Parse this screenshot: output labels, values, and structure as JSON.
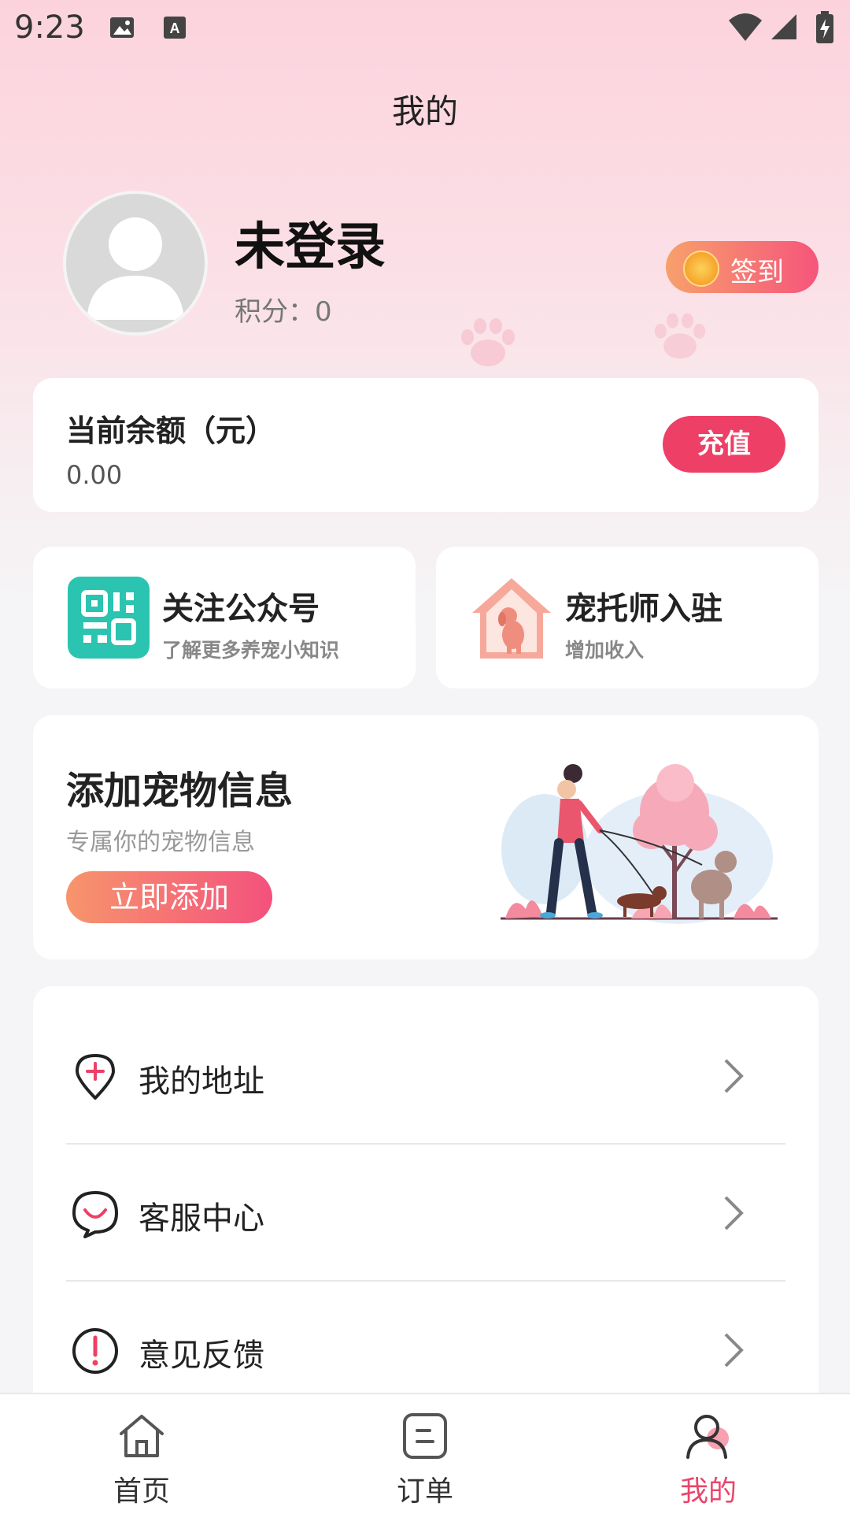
{
  "status_bar": {
    "time": "9:23"
  },
  "header": {
    "title": "我的"
  },
  "profile": {
    "name": "未登录",
    "points_label": "积分：",
    "points_value": "0",
    "checkin_label": "签到"
  },
  "balance": {
    "title": "当前余额（元）",
    "value": "0.00",
    "recharge_label": "充值"
  },
  "quick_cards": [
    {
      "title": "关注公众号",
      "subtitle": "了解更多养宠小知识",
      "icon": "qr-code-icon"
    },
    {
      "title": "宠托师入驻",
      "subtitle": "增加收入",
      "icon": "pet-house-icon"
    }
  ],
  "pet_banner": {
    "title": "添加宠物信息",
    "subtitle": "专属你的宠物信息",
    "button_label": "立即添加"
  },
  "menu": [
    {
      "label": "我的地址",
      "icon": "location-pin-icon"
    },
    {
      "label": "客服中心",
      "icon": "chat-bubble-icon"
    },
    {
      "label": "意见反馈",
      "icon": "exclamation-icon"
    }
  ],
  "tabs": [
    {
      "label": "首页",
      "icon": "home-icon"
    },
    {
      "label": "订单",
      "icon": "order-icon"
    },
    {
      "label": "我的",
      "icon": "profile-icon",
      "active": true
    }
  ],
  "colors": {
    "accent": "#ee3f66",
    "active_tab": "#e9466b",
    "gradient_start": "#f7956c",
    "gradient_end": "#f4517d"
  }
}
